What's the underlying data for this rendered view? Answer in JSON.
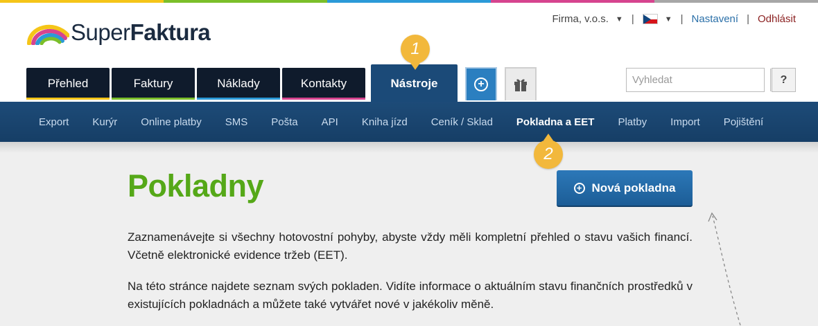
{
  "colors": {
    "stripe": [
      "#f5c518",
      "#7bbf2a",
      "#2b9ad8",
      "#d6448f",
      "#a7a7a7"
    ],
    "tab_underlines": [
      "#f5c518",
      "#7bbf2a",
      "#2b9ad8",
      "#d6448f"
    ],
    "title_green": "#55a818",
    "subnav_blue": "#1d4b78",
    "badge_yellow": "#f2b83c"
  },
  "logo": {
    "text_light": "Super",
    "text_bold": "Faktura"
  },
  "topbar": {
    "company": "Firma, v.o.s.",
    "language_flag": "czech-flag",
    "settings": "Nastavení",
    "logout": "Odhlásit"
  },
  "tabs": [
    {
      "label": "Přehled"
    },
    {
      "label": "Faktury"
    },
    {
      "label": "Náklady"
    },
    {
      "label": "Kontakty"
    }
  ],
  "active_tab": "Nástroje",
  "search": {
    "placeholder": "Vyhledat"
  },
  "help_label": "?",
  "subnav": [
    "Export",
    "Kurýr",
    "Online platby",
    "SMS",
    "Pošta",
    "API",
    "Kniha jízd",
    "Ceník / Sklad",
    "Pokladna a EET",
    "Platby",
    "Import",
    "Pojištění"
  ],
  "subnav_active": "Pokladna a EET",
  "badges": {
    "one": "1",
    "two": "2"
  },
  "page": {
    "title": "Pokladny",
    "new_button": "Nová pokladna",
    "paragraph1": "Zaznamenávejte si všechny hotovostní pohyby, abyste vždy měli kompletní přehled o stavu vašich financí. Včetně elektronické evidence tržeb (EET).",
    "paragraph2": "Na této stránce najdete seznam svých pokladen. Vidíte informace o aktuálním stavu finančních prostředků v existujících pokladnách a můžete také vytvářet nové v jakékoliv měně."
  }
}
